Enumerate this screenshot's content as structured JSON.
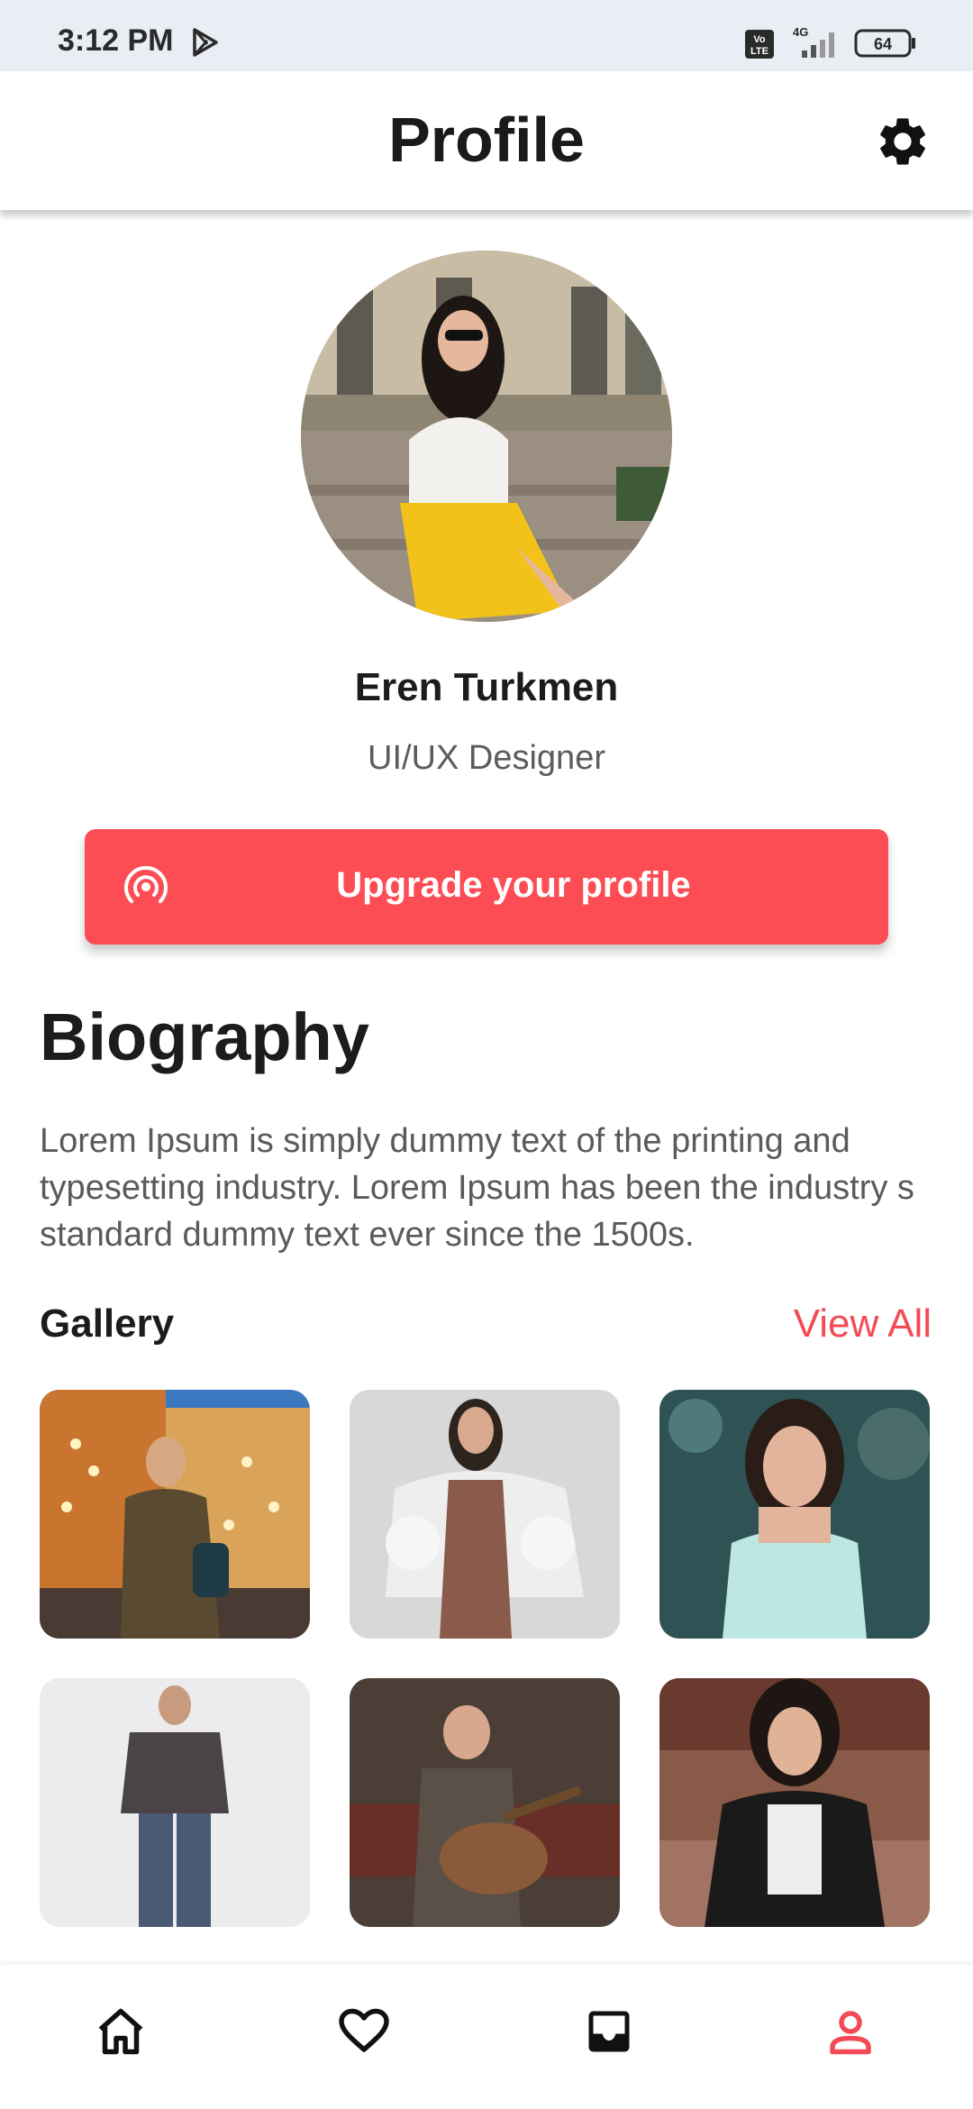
{
  "status_bar": {
    "time": "3:12 PM",
    "network": "4G",
    "battery": "64",
    "volte": "Vo LTE"
  },
  "app_bar": {
    "title": "Profile",
    "settings_icon": "gear-icon"
  },
  "profile": {
    "name": "Eren Turkmen",
    "role": "UI/UX Designer"
  },
  "upgrade": {
    "label": "Upgrade your profile",
    "icon": "broadcast-icon",
    "color": "#fc4d55"
  },
  "biography": {
    "title": "Biography",
    "text": "Lorem Ipsum is simply dummy text of the printing and typesetting industry. Lorem Ipsum has been the industry s standard dummy text ever since the 1500s."
  },
  "gallery": {
    "title": "Gallery",
    "view_all_label": "View All",
    "accent": "#f24b55"
  },
  "bottom_nav": {
    "items": [
      {
        "icon": "home-icon",
        "active": false
      },
      {
        "icon": "heart-icon",
        "active": false
      },
      {
        "icon": "inbox-icon",
        "active": false
      },
      {
        "icon": "person-icon",
        "active": true
      }
    ],
    "active_color": "#f24b55"
  }
}
